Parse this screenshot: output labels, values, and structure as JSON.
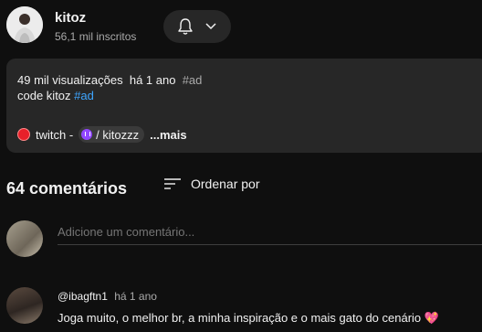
{
  "channel": {
    "name": "kitoz",
    "subscribers": "56,1 mil inscritos"
  },
  "description": {
    "views": "49 mil visualizações",
    "age": "há 1 ano",
    "tag": "#ad",
    "line2_text": "code kitoz",
    "line2_hashtag": "#ad",
    "twitch_label": "twitch -",
    "chip_label": "/ kitozzz",
    "more_label": "...mais"
  },
  "comments": {
    "count_label": "64 comentários",
    "sort_label": "Ordenar por",
    "add_placeholder": "Adicione um comentário...",
    "items": [
      {
        "user": "@ibagftn1",
        "time": "há 1 ano",
        "text": "Joga muito, o melhor br, a minha inspiração e o mais gato do cenário",
        "emoji": "💖"
      }
    ]
  },
  "colors": {
    "background": "#0f0f0f",
    "panel": "#272727",
    "link": "#3ea6ff",
    "twitch": "#9146ff",
    "live_red": "#e8202a"
  }
}
